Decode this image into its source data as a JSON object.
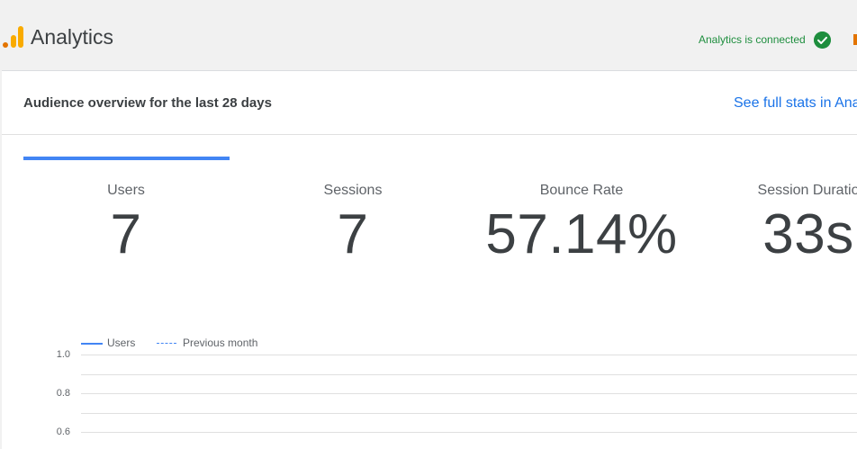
{
  "header": {
    "app_title": "Analytics",
    "status_text": "Analytics is connected",
    "logo_icon": "analytics-bars-icon",
    "status_icon": "check-circle-icon",
    "brand_colors": {
      "orange": "#f9ab00",
      "dark_orange": "#e37400",
      "green": "#1e8e3e",
      "blue": "#1a73e8"
    }
  },
  "card": {
    "title": "Audience overview for the last 28 days",
    "link_text": "See full stats in Ana"
  },
  "metrics": [
    {
      "label": "Users",
      "value": "7"
    },
    {
      "label": "Sessions",
      "value": "7"
    },
    {
      "label": "Bounce Rate",
      "value": "57.14%"
    },
    {
      "label": "Session Duratio",
      "value": "33s"
    }
  ],
  "chart": {
    "legend": [
      "Users",
      "Previous month"
    ],
    "y_ticks": [
      "1.0",
      "0.8",
      "0.6"
    ]
  }
}
